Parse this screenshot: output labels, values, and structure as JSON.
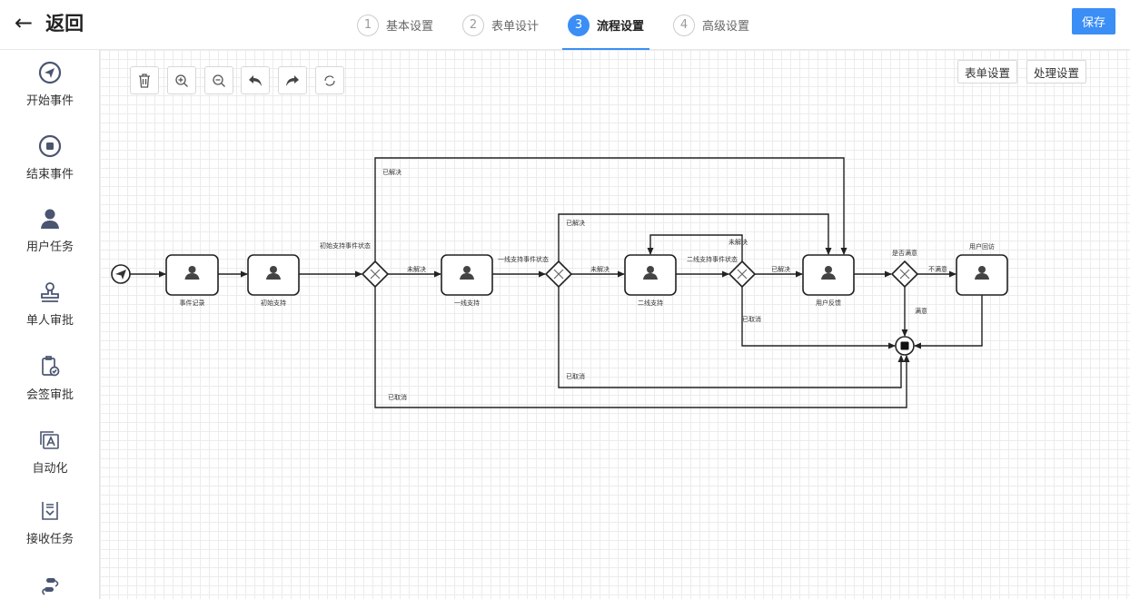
{
  "header": {
    "back_label": "返回",
    "save_label": "保存",
    "steps": [
      {
        "num": "1",
        "label": "基本设置"
      },
      {
        "num": "2",
        "label": "表单设计"
      },
      {
        "num": "3",
        "label": "流程设置",
        "active": true
      },
      {
        "num": "4",
        "label": "高级设置"
      }
    ]
  },
  "sidebar": {
    "items": [
      {
        "label": "开始事件",
        "icon": "paper-plane-icon"
      },
      {
        "label": "结束事件",
        "icon": "stop-circle-icon"
      },
      {
        "label": "用户任务",
        "icon": "user-icon"
      },
      {
        "label": "单人审批",
        "icon": "stamp-icon"
      },
      {
        "label": "会签审批",
        "icon": "clipboard-check-icon"
      },
      {
        "label": "自动化",
        "icon": "automation-icon"
      },
      {
        "label": "接收任务",
        "icon": "receive-task-icon"
      },
      {
        "label": "",
        "icon": "flow-icon"
      }
    ]
  },
  "toolbar": {
    "buttons": [
      "delete",
      "zoom-in",
      "zoom-out",
      "undo",
      "redo",
      "reset"
    ],
    "form_settings": "表单设置",
    "process_settings": "处理设置"
  },
  "colors": {
    "accent": "#3a8ef6"
  },
  "diagram": {
    "tasks": [
      "事件记录",
      "初始支持",
      "一线支持",
      "二线支持",
      "用户反馈",
      "用户回访"
    ],
    "gateways": [
      "初始支持事件状态",
      "一线支持事件状态",
      "二线支持事件状态",
      "是否满意"
    ],
    "edges": {
      "g1_resolved": "已解决",
      "g1_unresolved": "未解决",
      "g1_cancelled": "已取消",
      "g2_resolved": "已解决",
      "g2_unresolved": "未解决",
      "g2_cancelled": "已取消",
      "g3_unresolved": "未解决",
      "g3_resolved": "已解决",
      "g3_cancelled": "已取消",
      "g4_unsatisfied": "不满意",
      "g4_satisfied": "满意"
    }
  }
}
